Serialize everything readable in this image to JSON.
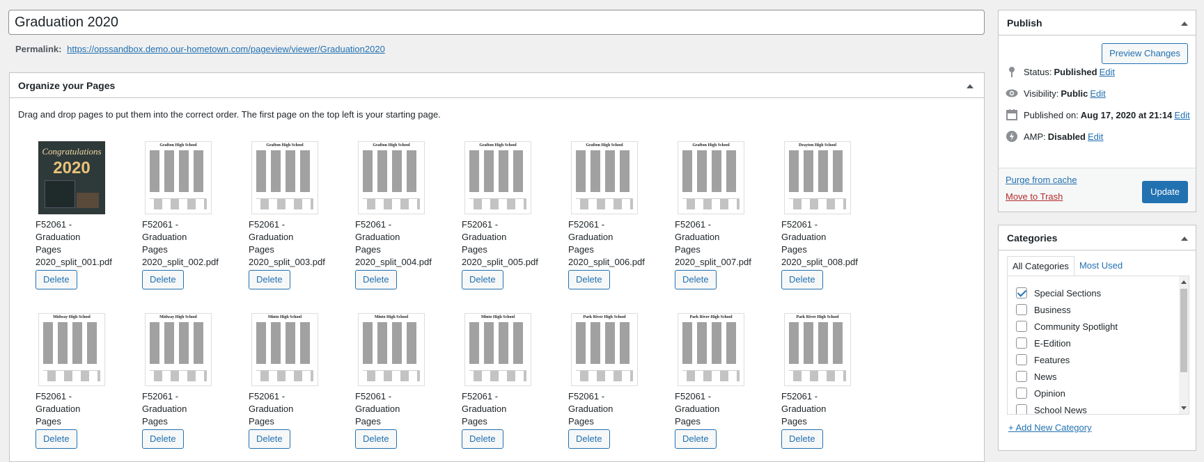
{
  "post": {
    "title": "Graduation 2020",
    "permalink_label": "Permalink:",
    "permalink_url": "https://opssandbox.demo.our-hometown.com/pageview/viewer/Graduation2020"
  },
  "organize": {
    "heading": "Organize your Pages",
    "description": "Drag and drop pages to put them into the correct order. The first page on the top left is your starting page.",
    "delete_label": "Delete",
    "pages": [
      {
        "school": "",
        "cover": true,
        "cover_title": "Congratulations",
        "cover_year": "2020",
        "file_lines": [
          "F52061 -",
          "Graduation",
          "Pages",
          "2020_split_001.pdf"
        ]
      },
      {
        "school": "Grafton High School",
        "file_lines": [
          "F52061 -",
          "Graduation",
          "Pages",
          "2020_split_002.pdf"
        ]
      },
      {
        "school": "Grafton High School",
        "file_lines": [
          "F52061 -",
          "Graduation",
          "Pages",
          "2020_split_003.pdf"
        ]
      },
      {
        "school": "Grafton High School",
        "file_lines": [
          "F52061 -",
          "Graduation",
          "Pages",
          "2020_split_004.pdf"
        ]
      },
      {
        "school": "Grafton High School",
        "file_lines": [
          "F52061 -",
          "Graduation",
          "Pages",
          "2020_split_005.pdf"
        ]
      },
      {
        "school": "Grafton High School",
        "file_lines": [
          "F52061 -",
          "Graduation",
          "Pages",
          "2020_split_006.pdf"
        ]
      },
      {
        "school": "Grafton High School",
        "file_lines": [
          "F52061 -",
          "Graduation",
          "Pages",
          "2020_split_007.pdf"
        ]
      },
      {
        "school": "Drayton High School",
        "file_lines": [
          "F52061 -",
          "Graduation",
          "Pages",
          "2020_split_008.pdf"
        ]
      },
      {
        "school": "Midway High School",
        "file_lines": [
          "F52061 -",
          "Graduation",
          "Pages"
        ]
      },
      {
        "school": "Midway High School",
        "file_lines": [
          "F52061 -",
          "Graduation",
          "Pages"
        ]
      },
      {
        "school": "Minto High School",
        "file_lines": [
          "F52061 -",
          "Graduation",
          "Pages"
        ]
      },
      {
        "school": "Minto High School",
        "file_lines": [
          "F52061 -",
          "Graduation",
          "Pages"
        ]
      },
      {
        "school": "Minto High School",
        "file_lines": [
          "F52061 -",
          "Graduation",
          "Pages"
        ]
      },
      {
        "school": "Park River High School",
        "file_lines": [
          "F52061 -",
          "Graduation",
          "Pages"
        ]
      },
      {
        "school": "Park River High School",
        "file_lines": [
          "F52061 -",
          "Graduation",
          "Pages"
        ]
      },
      {
        "school": "Park River High School",
        "file_lines": [
          "F52061 -",
          "Graduation",
          "Pages"
        ]
      }
    ]
  },
  "publish": {
    "heading": "Publish",
    "preview_label": "Preview Changes",
    "status_label": "Status:",
    "status_value": "Published",
    "visibility_label": "Visibility:",
    "visibility_value": "Public",
    "published_label": "Published on:",
    "published_value": "Aug 17, 2020 at 21:14",
    "amp_label": "AMP:",
    "amp_value": "Disabled",
    "edit_label": "Edit",
    "purge_label": "Purge from cache",
    "trash_label": "Move to Trash",
    "update_label": "Update"
  },
  "categories": {
    "heading": "Categories",
    "tab_all": "All Categories",
    "tab_most_used": "Most Used",
    "items": [
      {
        "label": "Special Sections",
        "checked": true
      },
      {
        "label": "Business",
        "checked": false
      },
      {
        "label": "Community Spotlight",
        "checked": false
      },
      {
        "label": "E-Edition",
        "checked": false
      },
      {
        "label": "Features",
        "checked": false
      },
      {
        "label": "News",
        "checked": false
      },
      {
        "label": "Opinion",
        "checked": false
      },
      {
        "label": "School News",
        "checked": false
      }
    ],
    "add_new_label": "+ Add New Category"
  },
  "colors": {
    "accent": "#2271b1",
    "danger": "#b32d2e",
    "background": "#f0f0f1"
  }
}
